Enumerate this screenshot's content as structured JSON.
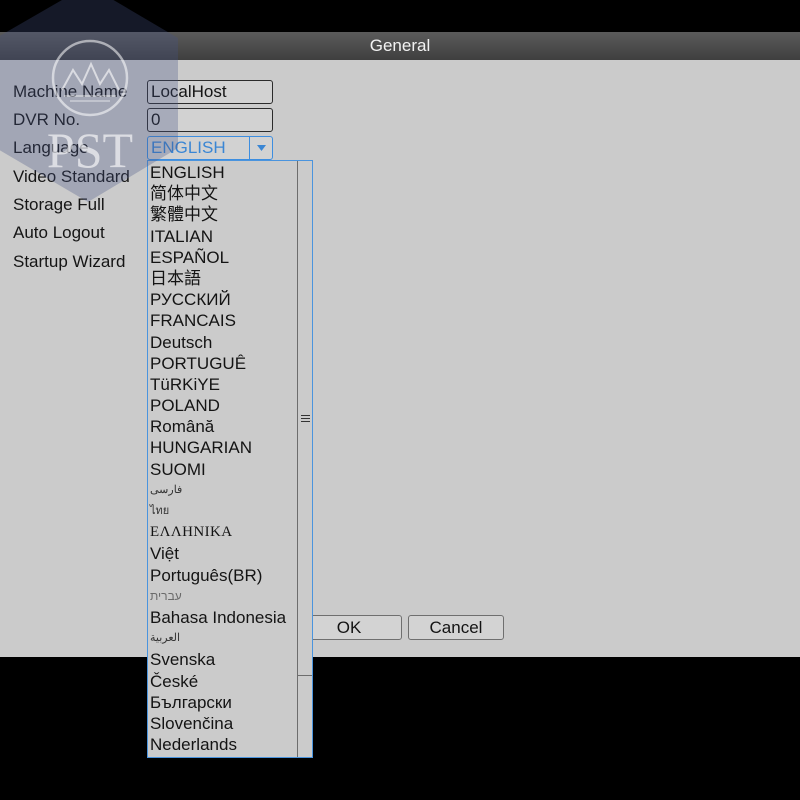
{
  "window": {
    "title": "General"
  },
  "watermark": {
    "text": "PST"
  },
  "form": {
    "labels": {
      "machine_name": "Machine Name",
      "dvr_no": "DVR No.",
      "language": "Language",
      "video_standard": "Video Standard",
      "storage_full": "Storage Full",
      "auto_logout": "Auto Logout",
      "startup_wizard": "Startup Wizard"
    },
    "machine_name_value": "LocalHost",
    "dvr_no_value": "0",
    "language_selected": "ENGLISH"
  },
  "language_dropdown": {
    "expanded": true,
    "options": [
      "ENGLISH",
      "简体中文",
      "繁體中文",
      "ITALIAN",
      "ESPAÑOL",
      "日本語",
      "РУССКИЙ",
      "FRANCAIS",
      "Deutsch",
      "PORTUGUÊ",
      "TüRKiYE",
      "POLAND",
      "Română",
      "HUNGARIAN",
      "SUOMI",
      "فارسی",
      "ไทย",
      "ΕΛΛΗΝΙΚΑ",
      "Việt",
      "Português(BR)",
      "עברית",
      "Bahasa Indonesia",
      "العربية",
      "Svenska",
      "České",
      "Български",
      "Slovenčina",
      "Nederlands"
    ]
  },
  "buttons": {
    "ok": "OK",
    "cancel": "Cancel"
  },
  "icons": {
    "dropdown_arrow": "chevron-down-icon",
    "scrollbar_grip": "grip-lines-icon",
    "watermark_logo": "mountain-circle-logo-icon"
  },
  "colors": {
    "accent": "#3d8ee0",
    "panel": "#cbcbcb",
    "title_bar": "#474747",
    "background": "#000000"
  }
}
